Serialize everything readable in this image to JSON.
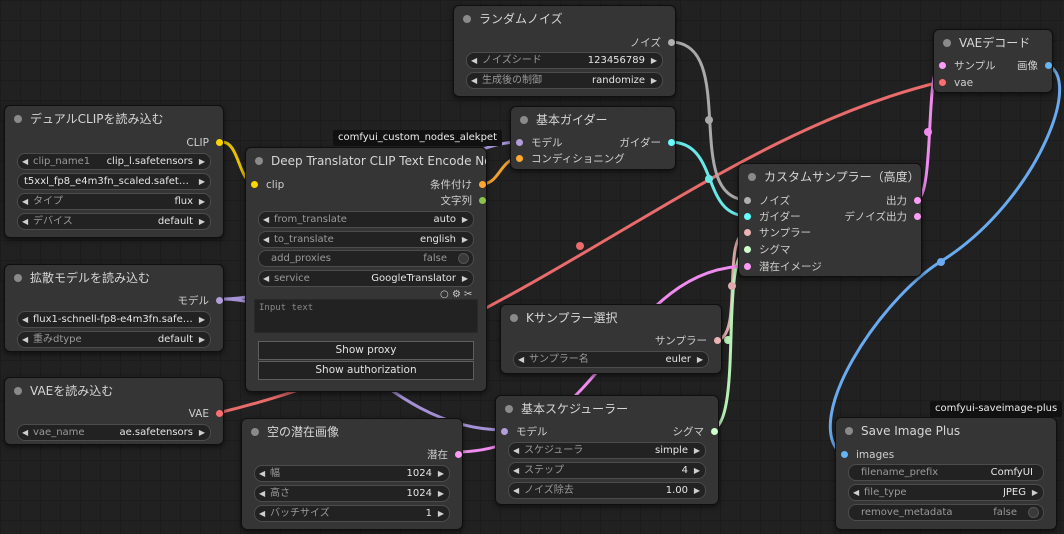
{
  "colors": {
    "clip": "#ffd500",
    "model": "#b39ddb",
    "conditioning": "#ffa931",
    "string": "#8bc34a",
    "vae": "#ff6e6e",
    "latent": "#ff9cf9",
    "noise": "#b0b0b0",
    "guider": "#66ffff",
    "sampler": "#ecb4b4",
    "sigmas": "#cdffcd",
    "image": "#64b5f6"
  },
  "badges": {
    "alekpet": "comfyui_custom_nodes_alekpet",
    "saveplus": "comfyui-saveimage-plus"
  },
  "dualclip": {
    "title": "デュアルCLIPを読み込む",
    "out_clip": "CLIP",
    "w_clip_name1_label": "clip_name1",
    "w_clip_name1_value": "clip_l.safetensors",
    "w_clip_name2_value": "t5xxl_fp8_e4m3fn_scaled.safete ...",
    "w_type_label": "タイプ",
    "w_type_value": "flux",
    "w_device_label": "デバイス",
    "w_device_value": "default"
  },
  "diffusion": {
    "title": "拡散モデルを読み込む",
    "out_model": "モデル",
    "w_unet_value": "flux1-schnell-fp8-e4m3fn.safeten ...",
    "w_dtype_label": "重みdtype",
    "w_dtype_value": "default"
  },
  "vaeloader": {
    "title": "VAEを読み込む",
    "out_vae": "VAE",
    "w_vae_label": "vae_name",
    "w_vae_value": "ae.safetensors"
  },
  "translator": {
    "title": "Deep Translator CLIP Text Encode Node",
    "in_clip": "clip",
    "out_cond": "条件付け",
    "out_string": "文字列",
    "w_from_label": "from_translate",
    "w_from_value": "auto",
    "w_to_label": "to_translate",
    "w_to_value": "english",
    "w_proxies_label": "add_proxies",
    "w_proxies_value": "false",
    "w_service_label": "service",
    "w_service_value": "GoogleTranslator",
    "text_placeholder": "Input text",
    "btn_proxy": "Show proxy",
    "btn_auth": "Show authorization"
  },
  "noise": {
    "title": "ランダムノイズ",
    "out_noise": "ノイズ",
    "w_seed_label": "ノイズシード",
    "w_seed_value": "123456789",
    "w_ctrl_label": "生成後の制御",
    "w_ctrl_value": "randomize"
  },
  "guider": {
    "title": "基本ガイダー",
    "in_model": "モデル",
    "in_cond": "コンディショニング",
    "out_guider": "ガイダー"
  },
  "customsampler": {
    "title": "カスタムサンプラー（高度）",
    "in_noise": "ノイズ",
    "in_guider": "ガイダー",
    "in_sampler": "サンプラー",
    "in_sigmas": "シグマ",
    "in_latent": "潜在イメージ",
    "out_output": "出力",
    "out_denoised": "デノイズ出力"
  },
  "vaedecode": {
    "title": "VAEデコード",
    "in_samples": "サンプル",
    "in_vae": "vae",
    "out_image": "画像"
  },
  "ksampler": {
    "title": "Kサンプラー選択",
    "out_sampler": "サンプラー",
    "w_sampler_label": "サンプラー名",
    "w_sampler_value": "euler"
  },
  "scheduler": {
    "title": "基本スケジューラー",
    "in_model": "モデル",
    "out_sigmas": "シグマ",
    "w_sched_label": "スケジューラ",
    "w_sched_value": "simple",
    "w_steps_label": "ステップ",
    "w_steps_value": "4",
    "w_denoise_label": "ノイズ除去",
    "w_denoise_value": "1.00"
  },
  "emptylatent": {
    "title": "空の潜在画像",
    "out_latent": "潜在",
    "w_width_label": "幅",
    "w_width_value": "1024",
    "w_height_label": "高さ",
    "w_height_value": "1024",
    "w_batch_label": "バッチサイズ",
    "w_batch_value": "1"
  },
  "saveplus": {
    "title": "Save Image Plus",
    "in_images": "images",
    "w_prefix_label": "filename_prefix",
    "w_prefix_value": "ComfyUI",
    "w_filetype_label": "file_type",
    "w_filetype_value": "JPEG",
    "w_meta_label": "remove_metadata",
    "w_meta_value": "false"
  }
}
